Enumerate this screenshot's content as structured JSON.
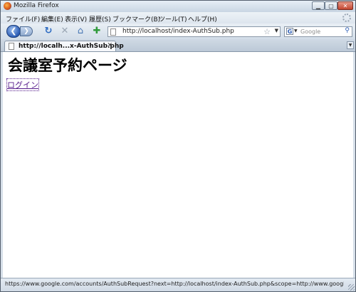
{
  "window": {
    "title": "Mozilla Firefox"
  },
  "menu": {
    "items": [
      "ファイル(F)",
      "編集(E)",
      "表示(V)",
      "履歴(S)",
      "ブックマーク(B)",
      "ツール(T)",
      "ヘルプ(H)"
    ]
  },
  "toolbar": {
    "url": "http://localhost/index-AuthSub.php",
    "search_placeholder": "Google",
    "search_engine_icon": "google-icon"
  },
  "tabs": [
    {
      "label": "http://localh...x-AuthSub.php",
      "active": true
    }
  ],
  "page": {
    "heading": "会議室予約ページ",
    "login_link": "ログイン"
  },
  "status": {
    "text": "https://www.google.com/accounts/AuthSubRequest?next=http://localhost/index-AuthSub.php&scope=http://www.google.co..."
  },
  "colors": {
    "visited_link": "#551a8b",
    "chrome": "#d6dfe9"
  }
}
